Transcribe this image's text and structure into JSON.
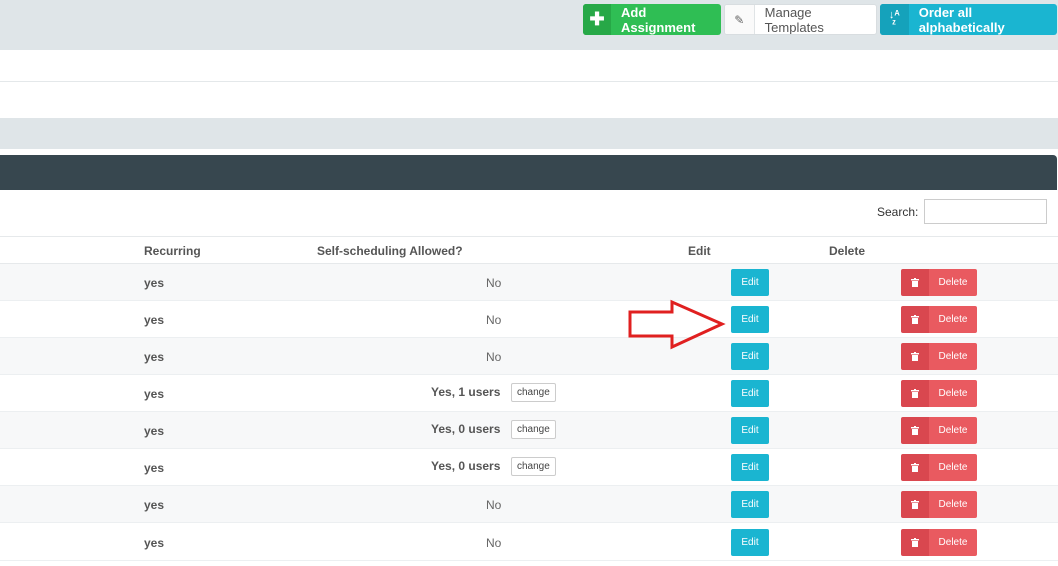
{
  "toolbar": {
    "add_icon": "plus-icon",
    "add_label": "Add Assignment",
    "templates_icon": "edit-icon",
    "templates_label": "Manage Templates",
    "order_icon": "sort-alpha-icon",
    "order_label": "Order all alphabetically"
  },
  "search": {
    "label": "Search:",
    "value": ""
  },
  "table": {
    "headers": {
      "recurring": "Recurring",
      "self_scheduling": "Self-scheduling Allowed?",
      "edit": "Edit",
      "delete": "Delete"
    },
    "rows": [
      {
        "recurring": "yes",
        "self_scheduling": "No",
        "change": "",
        "edit": "Edit",
        "delete": "Delete"
      },
      {
        "recurring": "yes",
        "self_scheduling": "No",
        "change": "",
        "edit": "Edit",
        "delete": "Delete"
      },
      {
        "recurring": "yes",
        "self_scheduling": "No",
        "change": "",
        "edit": "Edit",
        "delete": "Delete"
      },
      {
        "recurring": "yes",
        "self_scheduling": "Yes, 1 users",
        "change": "change",
        "edit": "Edit",
        "delete": "Delete"
      },
      {
        "recurring": "yes",
        "self_scheduling": "Yes, 0 users",
        "change": "change",
        "edit": "Edit",
        "delete": "Delete"
      },
      {
        "recurring": "yes",
        "self_scheduling": "Yes, 0 users",
        "change": "change",
        "edit": "Edit",
        "delete": "Delete"
      },
      {
        "recurring": "yes",
        "self_scheduling": "No",
        "change": "",
        "edit": "Edit",
        "delete": "Delete"
      },
      {
        "recurring": "yes",
        "self_scheduling": "No",
        "change": "",
        "edit": "Edit",
        "delete": "Delete"
      }
    ]
  },
  "annotation": {
    "arrow_icon": "right-arrow-icon",
    "color": "#e02020"
  },
  "colors": {
    "green": "#2fbe54",
    "cyan": "#1ab5d1",
    "red": "#e95a60",
    "dark_header": "#37474f"
  }
}
